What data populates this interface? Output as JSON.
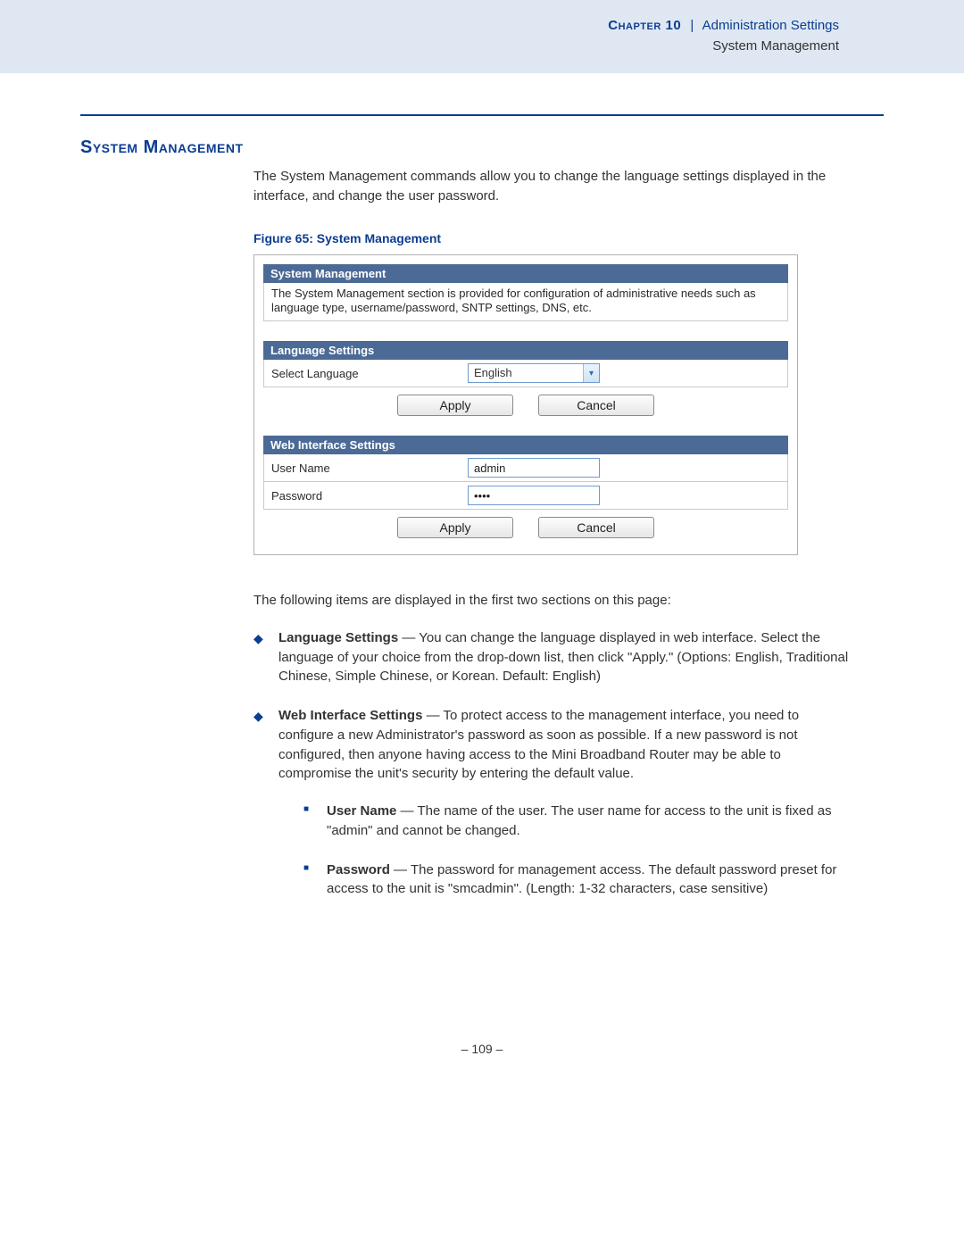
{
  "header": {
    "chapter_label": "Chapter 10",
    "breadcrumb": "Administration Settings",
    "subtitle": "System Management"
  },
  "section_title": "System Management",
  "intro": "The System Management commands allow you to change the language settings displayed in the interface, and change the user password.",
  "figure": {
    "caption": "Figure 65:  System Management",
    "sm_header": "System Management",
    "sm_desc": "The System Management section is provided for configuration of administrative needs such as language type, username/password, SNTP settings, DNS, etc.",
    "lang_header": "Language Settings",
    "lang_label": "Select Language",
    "lang_value": "English",
    "web_header": "Web Interface Settings",
    "user_label": "User Name",
    "user_value": "admin",
    "pass_label": "Password",
    "pass_value": "••••",
    "apply": "Apply",
    "cancel": "Cancel"
  },
  "after_intro": "The following items are displayed in the first two sections on this page:",
  "bullets": {
    "lang_title": "Language Settings",
    "lang_body": " — You can change the language displayed in web interface. Select the language of your choice from the drop-down list, then click \"Apply.\" (Options: English, Traditional Chinese, Simple Chinese, or Korean. Default: English)",
    "web_title": "Web Interface Settings",
    "web_body": " — To protect access to the management interface, you need to configure a new Administrator's password as soon as possible. If a new password is not configured, then anyone having access to the Mini Broadband Router may be able to compromise the unit's security by entering the default value.",
    "user_title": "User Name",
    "user_body": " — The name of the user. The user name for access to the unit is fixed as \"admin\" and cannot be changed.",
    "pass_title": "Password",
    "pass_body": " — The password for management access. The default password preset for access to the unit is \"smcadmin\". (Length: 1-32 characters, case sensitive)"
  },
  "page_number": "–  109  –"
}
